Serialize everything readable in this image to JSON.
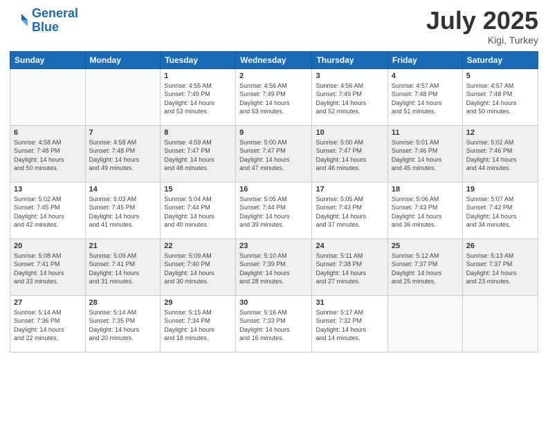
{
  "logo": {
    "line1": "General",
    "line2": "Blue"
  },
  "title": "July 2025",
  "location": "Kigi, Turkey",
  "headers": [
    "Sunday",
    "Monday",
    "Tuesday",
    "Wednesday",
    "Thursday",
    "Friday",
    "Saturday"
  ],
  "weeks": [
    [
      {
        "day": "",
        "info": ""
      },
      {
        "day": "",
        "info": ""
      },
      {
        "day": "1",
        "info": "Sunrise: 4:55 AM\nSunset: 7:49 PM\nDaylight: 14 hours\nand 53 minutes."
      },
      {
        "day": "2",
        "info": "Sunrise: 4:56 AM\nSunset: 7:49 PM\nDaylight: 14 hours\nand 53 minutes."
      },
      {
        "day": "3",
        "info": "Sunrise: 4:56 AM\nSunset: 7:49 PM\nDaylight: 14 hours\nand 52 minutes."
      },
      {
        "day": "4",
        "info": "Sunrise: 4:57 AM\nSunset: 7:48 PM\nDaylight: 14 hours\nand 51 minutes."
      },
      {
        "day": "5",
        "info": "Sunrise: 4:57 AM\nSunset: 7:48 PM\nDaylight: 14 hours\nand 50 minutes."
      }
    ],
    [
      {
        "day": "6",
        "info": "Sunrise: 4:58 AM\nSunset: 7:48 PM\nDaylight: 14 hours\nand 50 minutes."
      },
      {
        "day": "7",
        "info": "Sunrise: 4:58 AM\nSunset: 7:48 PM\nDaylight: 14 hours\nand 49 minutes."
      },
      {
        "day": "8",
        "info": "Sunrise: 4:59 AM\nSunset: 7:47 PM\nDaylight: 14 hours\nand 48 minutes."
      },
      {
        "day": "9",
        "info": "Sunrise: 5:00 AM\nSunset: 7:47 PM\nDaylight: 14 hours\nand 47 minutes."
      },
      {
        "day": "10",
        "info": "Sunrise: 5:00 AM\nSunset: 7:47 PM\nDaylight: 14 hours\nand 46 minutes."
      },
      {
        "day": "11",
        "info": "Sunrise: 5:01 AM\nSunset: 7:46 PM\nDaylight: 14 hours\nand 45 minutes."
      },
      {
        "day": "12",
        "info": "Sunrise: 5:02 AM\nSunset: 7:46 PM\nDaylight: 14 hours\nand 44 minutes."
      }
    ],
    [
      {
        "day": "13",
        "info": "Sunrise: 5:02 AM\nSunset: 7:45 PM\nDaylight: 14 hours\nand 42 minutes."
      },
      {
        "day": "14",
        "info": "Sunrise: 5:03 AM\nSunset: 7:45 PM\nDaylight: 14 hours\nand 41 minutes."
      },
      {
        "day": "15",
        "info": "Sunrise: 5:04 AM\nSunset: 7:44 PM\nDaylight: 14 hours\nand 40 minutes."
      },
      {
        "day": "16",
        "info": "Sunrise: 5:05 AM\nSunset: 7:44 PM\nDaylight: 14 hours\nand 39 minutes."
      },
      {
        "day": "17",
        "info": "Sunrise: 5:05 AM\nSunset: 7:43 PM\nDaylight: 14 hours\nand 37 minutes."
      },
      {
        "day": "18",
        "info": "Sunrise: 5:06 AM\nSunset: 7:43 PM\nDaylight: 14 hours\nand 36 minutes."
      },
      {
        "day": "19",
        "info": "Sunrise: 5:07 AM\nSunset: 7:42 PM\nDaylight: 14 hours\nand 34 minutes."
      }
    ],
    [
      {
        "day": "20",
        "info": "Sunrise: 5:08 AM\nSunset: 7:41 PM\nDaylight: 14 hours\nand 33 minutes."
      },
      {
        "day": "21",
        "info": "Sunrise: 5:09 AM\nSunset: 7:41 PM\nDaylight: 14 hours\nand 31 minutes."
      },
      {
        "day": "22",
        "info": "Sunrise: 5:09 AM\nSunset: 7:40 PM\nDaylight: 14 hours\nand 30 minutes."
      },
      {
        "day": "23",
        "info": "Sunrise: 5:10 AM\nSunset: 7:39 PM\nDaylight: 14 hours\nand 28 minutes."
      },
      {
        "day": "24",
        "info": "Sunrise: 5:11 AM\nSunset: 7:38 PM\nDaylight: 14 hours\nand 27 minutes."
      },
      {
        "day": "25",
        "info": "Sunrise: 5:12 AM\nSunset: 7:37 PM\nDaylight: 14 hours\nand 25 minutes."
      },
      {
        "day": "26",
        "info": "Sunrise: 5:13 AM\nSunset: 7:37 PM\nDaylight: 14 hours\nand 23 minutes."
      }
    ],
    [
      {
        "day": "27",
        "info": "Sunrise: 5:14 AM\nSunset: 7:36 PM\nDaylight: 14 hours\nand 22 minutes."
      },
      {
        "day": "28",
        "info": "Sunrise: 5:14 AM\nSunset: 7:35 PM\nDaylight: 14 hours\nand 20 minutes."
      },
      {
        "day": "29",
        "info": "Sunrise: 5:15 AM\nSunset: 7:34 PM\nDaylight: 14 hours\nand 18 minutes."
      },
      {
        "day": "30",
        "info": "Sunrise: 5:16 AM\nSunset: 7:33 PM\nDaylight: 14 hours\nand 16 minutes."
      },
      {
        "day": "31",
        "info": "Sunrise: 5:17 AM\nSunset: 7:32 PM\nDaylight: 14 hours\nand 14 minutes."
      },
      {
        "day": "",
        "info": ""
      },
      {
        "day": "",
        "info": ""
      }
    ]
  ]
}
